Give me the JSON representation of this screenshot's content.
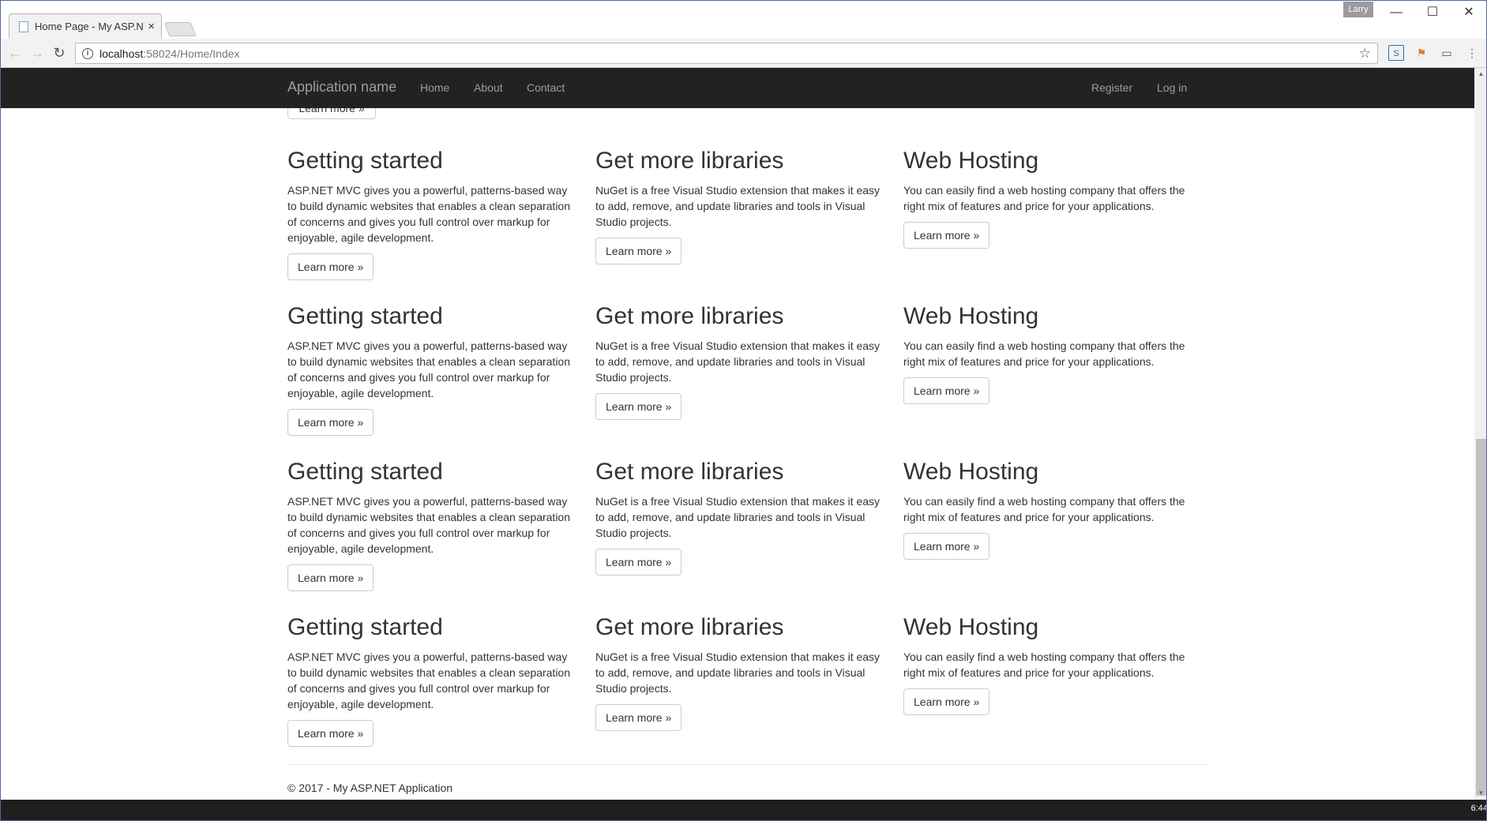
{
  "browser": {
    "tab_title": "Home Page - My ASP.NE",
    "profile_name": "Larry",
    "url_host": "localhost",
    "url_path": ":58024/Home/Index",
    "minimize": "—",
    "maximize": "☐",
    "close": "✕"
  },
  "navbar": {
    "brand": "Application name",
    "links": [
      "Home",
      "About",
      "Contact"
    ],
    "right_links": [
      "Register",
      "Log in"
    ]
  },
  "partial_button": "Learn more »",
  "rows": [
    {
      "cols": [
        {
          "heading": "Getting started",
          "text": "ASP.NET MVC gives you a powerful, patterns-based way to build dynamic websites that enables a clean separation of concerns and gives you full control over markup for enjoyable, agile development.",
          "button": "Learn more »"
        },
        {
          "heading": "Get more libraries",
          "text": "NuGet is a free Visual Studio extension that makes it easy to add, remove, and update libraries and tools in Visual Studio projects.",
          "button": "Learn more »"
        },
        {
          "heading": "Web Hosting",
          "text": "You can easily find a web hosting company that offers the right mix of features and price for your applications.",
          "button": "Learn more »"
        }
      ]
    },
    {
      "cols": [
        {
          "heading": "Getting started",
          "text": "ASP.NET MVC gives you a powerful, patterns-based way to build dynamic websites that enables a clean separation of concerns and gives you full control over markup for enjoyable, agile development.",
          "button": "Learn more »"
        },
        {
          "heading": "Get more libraries",
          "text": "NuGet is a free Visual Studio extension that makes it easy to add, remove, and update libraries and tools in Visual Studio projects.",
          "button": "Learn more »"
        },
        {
          "heading": "Web Hosting",
          "text": "You can easily find a web hosting company that offers the right mix of features and price for your applications.",
          "button": "Learn more »"
        }
      ]
    },
    {
      "cols": [
        {
          "heading": "Getting started",
          "text": "ASP.NET MVC gives you a powerful, patterns-based way to build dynamic websites that enables a clean separation of concerns and gives you full control over markup for enjoyable, agile development.",
          "button": "Learn more »"
        },
        {
          "heading": "Get more libraries",
          "text": "NuGet is a free Visual Studio extension that makes it easy to add, remove, and update libraries and tools in Visual Studio projects.",
          "button": "Learn more »"
        },
        {
          "heading": "Web Hosting",
          "text": "You can easily find a web hosting company that offers the right mix of features and price for your applications.",
          "button": "Learn more »"
        }
      ]
    },
    {
      "cols": [
        {
          "heading": "Getting started",
          "text": "ASP.NET MVC gives you a powerful, patterns-based way to build dynamic websites that enables a clean separation of concerns and gives you full control over markup for enjoyable, agile development.",
          "button": "Learn more »"
        },
        {
          "heading": "Get more libraries",
          "text": "NuGet is a free Visual Studio extension that makes it easy to add, remove, and update libraries and tools in Visual Studio projects.",
          "button": "Learn more »"
        },
        {
          "heading": "Web Hosting",
          "text": "You can easily find a web hosting company that offers the right mix of features and price for your applications.",
          "button": "Learn more »"
        }
      ]
    }
  ],
  "footer": "© 2017 - My ASP.NET Application",
  "taskbar": {
    "clock": "6:44"
  }
}
